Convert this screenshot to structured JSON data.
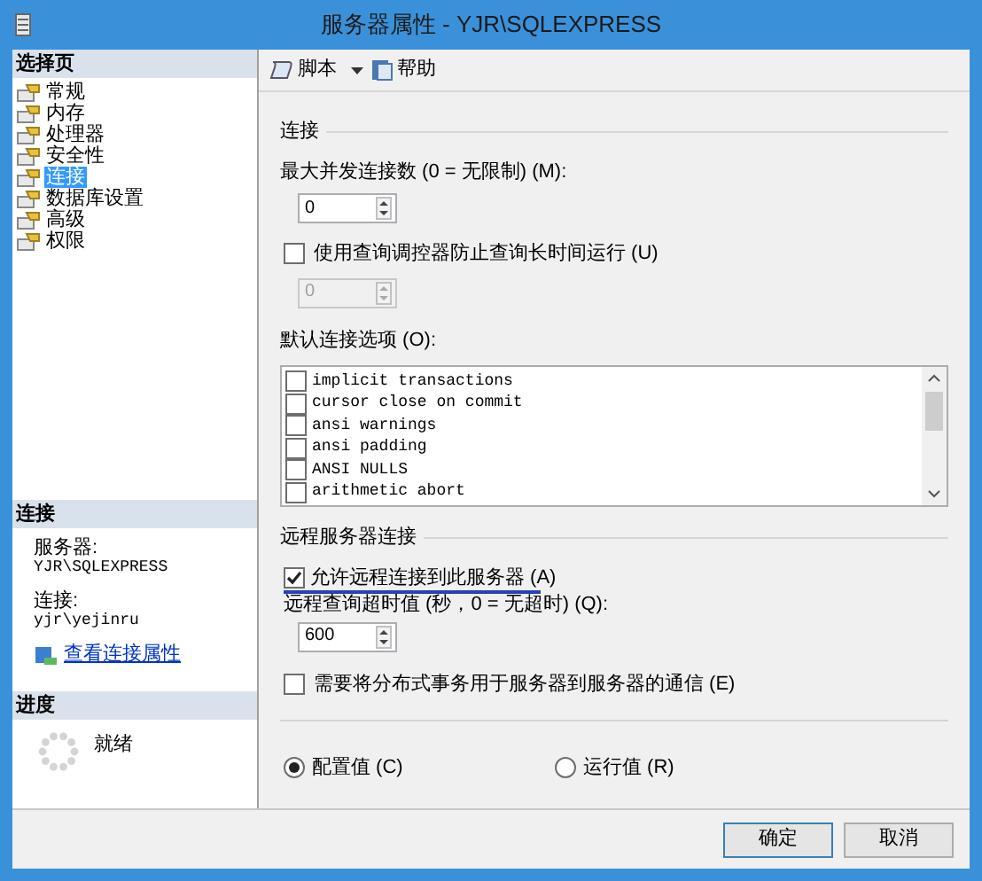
{
  "window": {
    "title": "服务器属性 - YJR\\SQLEXPRESS"
  },
  "sidebar": {
    "header": "选择页",
    "items": [
      {
        "label": "常规",
        "selected": false
      },
      {
        "label": "内存",
        "selected": false
      },
      {
        "label": "处理器",
        "selected": false
      },
      {
        "label": "安全性",
        "selected": false
      },
      {
        "label": "连接",
        "selected": true
      },
      {
        "label": "数据库设置",
        "selected": false
      },
      {
        "label": "高级",
        "selected": false
      },
      {
        "label": "权限",
        "selected": false
      }
    ]
  },
  "connection_panel": {
    "header": "连接",
    "server_label": "服务器:",
    "server": "YJR\\SQLEXPRESS",
    "connection_label": "连接:",
    "connection": "yjr\\yejinru",
    "link": "查看连接属性"
  },
  "progress_panel": {
    "header": "进度",
    "status": "就绪"
  },
  "toolbar": [
    {
      "label": "脚本",
      "kind": "dropdown"
    },
    {
      "label": "帮助",
      "kind": "button"
    }
  ],
  "connections": {
    "title": "连接",
    "max_label": "最大并发连接数 (0 = 无限制) (M):",
    "max_value": "0",
    "governor": {
      "label": "使用查询调控器防止查询长时间运行 (U)",
      "checked": false
    },
    "governor_value": {
      "value": "0",
      "disabled": true
    },
    "options_label": "默认连接选项 (O):",
    "options": [
      {
        "label": "implicit transactions",
        "checked": false
      },
      {
        "label": "cursor close on commit",
        "checked": false
      },
      {
        "label": "ansi warnings",
        "checked": false
      },
      {
        "label": "ansi padding",
        "checked": false
      },
      {
        "label": "ANSI NULLS",
        "checked": false
      },
      {
        "label": "arithmetic abort",
        "checked": false
      }
    ]
  },
  "remote": {
    "title": "远程服务器连接",
    "allow": {
      "label": "允许远程连接到此服务器 (A)",
      "checked": true
    },
    "timeout_label": "远程查询超时值 (秒，0 = 无超时) (Q):",
    "timeout_value": "600",
    "distributed": {
      "label": "需要将分布式事务用于服务器到服务器的通信 (E)",
      "checked": false
    }
  },
  "radios": [
    {
      "label": "配置值 (C)",
      "selected": true
    },
    {
      "label": "运行值 (R)",
      "selected": false
    }
  ],
  "buttons": [
    "确定",
    "取消"
  ]
}
